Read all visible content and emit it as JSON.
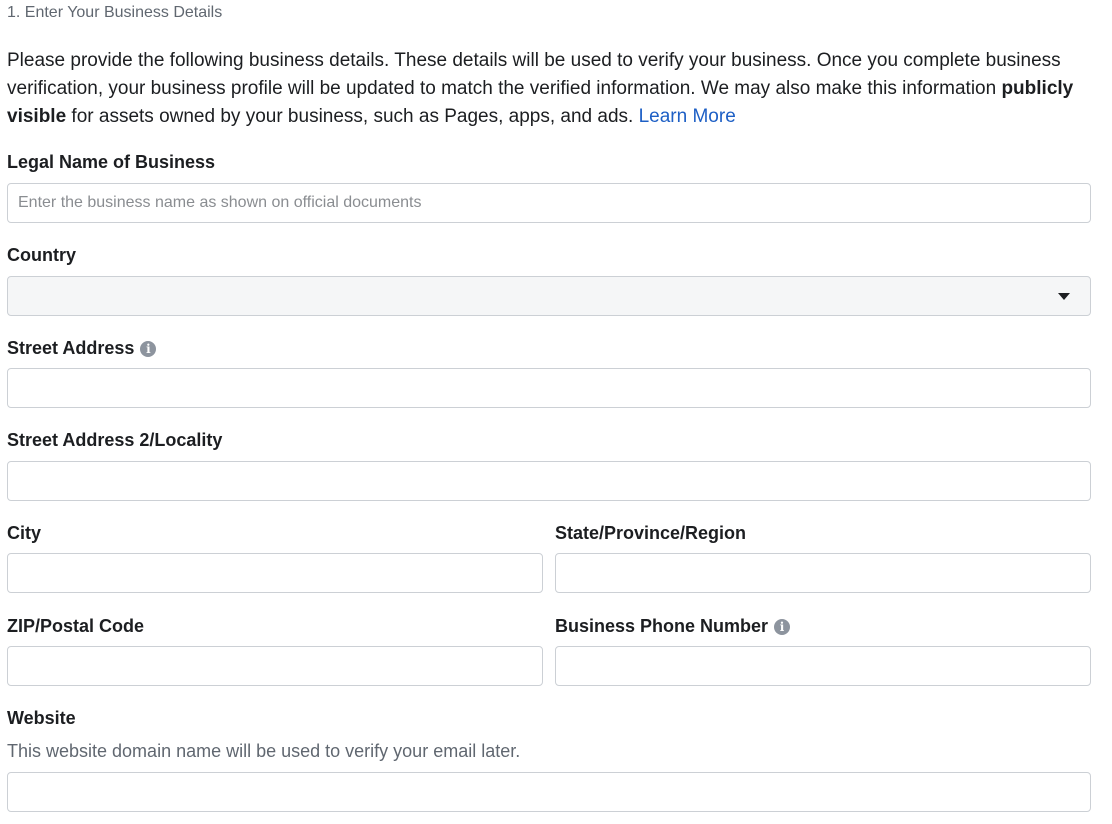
{
  "step_title": "1. Enter Your Business Details",
  "intro": {
    "part1": "Please provide the following business details. These details will be used to verify your business. Once you complete business verification, your business profile will be updated to match the verified information. We may also make this information ",
    "bold": "publicly visible",
    "part2": " for assets owned by your business, such as Pages, apps, and ads. ",
    "link": "Learn More"
  },
  "fields": {
    "legal_name": {
      "label": "Legal Name of Business",
      "placeholder": "Enter the business name as shown on official documents",
      "value": ""
    },
    "country": {
      "label": "Country",
      "value": ""
    },
    "street": {
      "label": "Street Address",
      "value": ""
    },
    "street2": {
      "label": "Street Address 2/Locality",
      "value": ""
    },
    "city": {
      "label": "City",
      "value": ""
    },
    "state": {
      "label": "State/Province/Region",
      "value": ""
    },
    "zip": {
      "label": "ZIP/Postal Code",
      "value": ""
    },
    "phone": {
      "label": "Business Phone Number",
      "value": ""
    },
    "website": {
      "label": "Website",
      "help": "This website domain name will be used to verify your email later.",
      "value": ""
    }
  },
  "icons": {
    "info": "info-icon",
    "dropdown": "caret-down-icon"
  },
  "colors": {
    "link": "#1d5fc5",
    "label": "#1c1e21",
    "muted": "#606770",
    "border": "#ccd0d5",
    "select_bg": "#f5f6f7"
  }
}
